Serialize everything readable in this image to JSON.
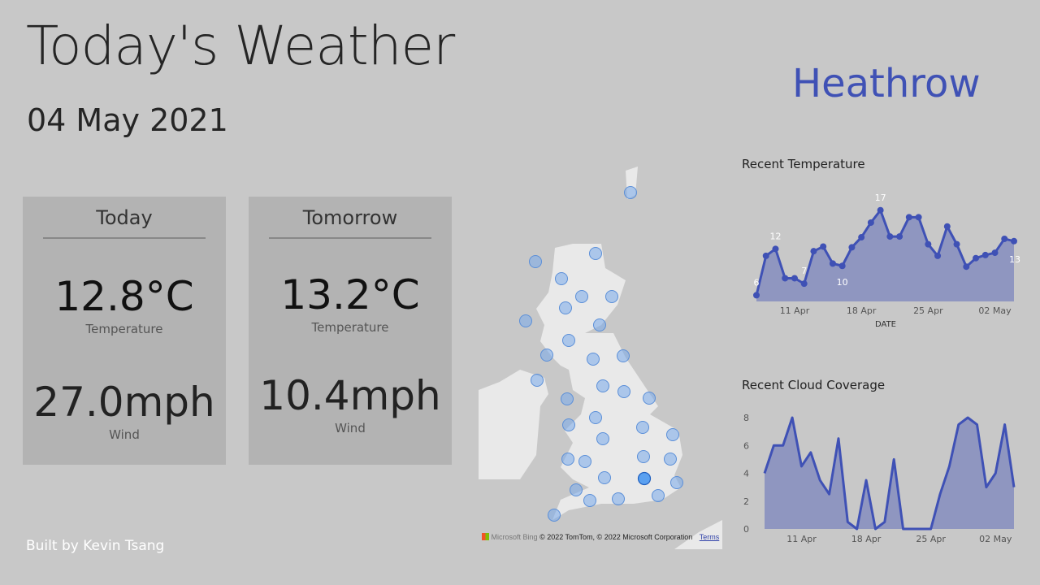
{
  "header": {
    "title": "Today's Weather",
    "date": "04 May 2021",
    "station": "Heathrow"
  },
  "today": {
    "label": "Today",
    "temperature": "12.8°C",
    "temperature_label": "Temperature",
    "wind": "27.0mph",
    "wind_label": "Wind"
  },
  "tomorrow": {
    "label": "Tomorrow",
    "temperature": "13.2°C",
    "temperature_label": "Temperature",
    "wind": "10.4mph",
    "wind_label": "Wind"
  },
  "footer": {
    "credit": "Built by Kevin Tsang"
  },
  "map": {
    "provider": "Microsoft Bing",
    "attribution": "© 2022 TomTom, © 2022 Microsoft Corporation",
    "terms": "Terms"
  },
  "colors": {
    "accent": "#3f51b5",
    "fill": "#8f96c0"
  },
  "chart_data": [
    {
      "type": "line",
      "title": "Recent Temperature",
      "xlabel": "DATE",
      "ylabel": "",
      "x": [
        "07 Apr",
        "08 Apr",
        "09 Apr",
        "10 Apr",
        "11 Apr",
        "12 Apr",
        "13 Apr",
        "14 Apr",
        "15 Apr",
        "16 Apr",
        "17 Apr",
        "18 Apr",
        "19 Apr",
        "20 Apr",
        "21 Apr",
        "22 Apr",
        "23 Apr",
        "24 Apr",
        "25 Apr",
        "26 Apr",
        "27 Apr",
        "28 Apr",
        "29 Apr",
        "30 Apr",
        "01 May",
        "02 May",
        "03 May",
        "04 May"
      ],
      "values": [
        6,
        11.1,
        12,
        8.2,
        8.2,
        7.5,
        11.7,
        12.3,
        10.1,
        9.8,
        12.2,
        13.5,
        15.4,
        17,
        13.6,
        13.6,
        16.1,
        16.1,
        12.6,
        11.1,
        14.9,
        12.6,
        9.7,
        10.8,
        11.2,
        11.5,
        13.3,
        13
      ],
      "data_labels": [
        {
          "index": 0,
          "text": "6"
        },
        {
          "index": 2,
          "text": "12"
        },
        {
          "index": 5,
          "text": "7"
        },
        {
          "index": 9,
          "text": "10"
        },
        {
          "index": 13,
          "text": "17"
        },
        {
          "index": 27,
          "text": "13"
        }
      ],
      "xticks": [
        {
          "index": 4,
          "label": "11 Apr"
        },
        {
          "index": 11,
          "label": "18 Apr"
        },
        {
          "index": 18,
          "label": "25 Apr"
        },
        {
          "index": 25,
          "label": "02 May"
        }
      ],
      "ylim": [
        5.2,
        17.5
      ]
    },
    {
      "type": "area",
      "title": "Recent Cloud Coverage",
      "xlabel": "",
      "ylabel": "",
      "values": [
        4,
        6,
        6,
        8,
        4.5,
        5.5,
        3.5,
        2.5,
        6.5,
        0.5,
        0,
        3.5,
        0,
        0.5,
        5,
        0,
        0,
        0,
        0,
        2.5,
        4.5,
        7.5,
        8,
        7.5,
        3,
        4,
        7.5,
        3
      ],
      "yticks": [
        0,
        2,
        4,
        6,
        8
      ],
      "xticks": [
        {
          "index": 4,
          "label": "11 Apr"
        },
        {
          "index": 11,
          "label": "18 Apr"
        },
        {
          "index": 18,
          "label": "25 Apr"
        },
        {
          "index": 25,
          "label": "02 May"
        }
      ],
      "ylim": [
        0,
        8
      ]
    }
  ]
}
